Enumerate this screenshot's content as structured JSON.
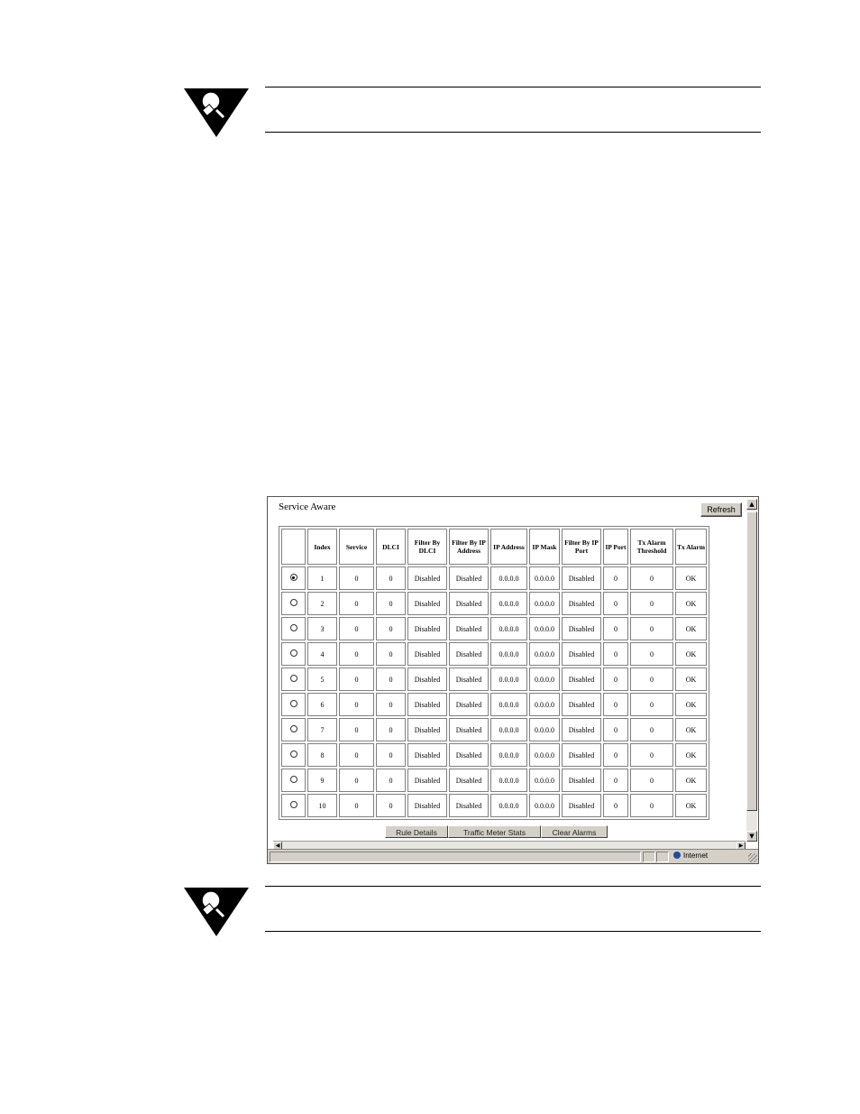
{
  "window": {
    "title": "Service Aware",
    "refresh_label": "Refresh"
  },
  "table": {
    "headers": [
      "",
      "Index",
      "Service",
      "DLCI",
      "Filter By DLCI",
      "Filter By IP Address",
      "IP Address",
      "IP Mask",
      "Filter By IP Port",
      "IP Port",
      "Tx Alarm Threshold",
      "Tx Alarm"
    ],
    "rows": [
      {
        "selected": true,
        "cells": [
          "1",
          "0",
          "0",
          "Disabled",
          "Disabled",
          "0.0.0.0",
          "0.0.0.0",
          "Disabled",
          "0",
          "0",
          "OK"
        ]
      },
      {
        "selected": false,
        "cells": [
          "2",
          "0",
          "0",
          "Disabled",
          "Disabled",
          "0.0.0.0",
          "0.0.0.0",
          "Disabled",
          "0",
          "0",
          "OK"
        ]
      },
      {
        "selected": false,
        "cells": [
          "3",
          "0",
          "0",
          "Disabled",
          "Disabled",
          "0.0.0.0",
          "0.0.0.0",
          "Disabled",
          "0",
          "0",
          "OK"
        ]
      },
      {
        "selected": false,
        "cells": [
          "4",
          "0",
          "0",
          "Disabled",
          "Disabled",
          "0.0.0.0",
          "0.0.0.0",
          "Disabled",
          "0",
          "0",
          "OK"
        ]
      },
      {
        "selected": false,
        "cells": [
          "5",
          "0",
          "0",
          "Disabled",
          "Disabled",
          "0.0.0.0",
          "0.0.0.0",
          "Disabled",
          "0",
          "0",
          "OK"
        ]
      },
      {
        "selected": false,
        "cells": [
          "6",
          "0",
          "0",
          "Disabled",
          "Disabled",
          "0.0.0.0",
          "0.0.0.0",
          "Disabled",
          "0",
          "0",
          "OK"
        ]
      },
      {
        "selected": false,
        "cells": [
          "7",
          "0",
          "0",
          "Disabled",
          "Disabled",
          "0.0.0.0",
          "0.0.0.0",
          "Disabled",
          "0",
          "0",
          "OK"
        ]
      },
      {
        "selected": false,
        "cells": [
          "8",
          "0",
          "0",
          "Disabled",
          "Disabled",
          "0.0.0.0",
          "0.0.0.0",
          "Disabled",
          "0",
          "0",
          "OK"
        ]
      },
      {
        "selected": false,
        "cells": [
          "9",
          "0",
          "0",
          "Disabled",
          "Disabled",
          "0.0.0.0",
          "0.0.0.0",
          "Disabled",
          "0",
          "0",
          "OK"
        ]
      },
      {
        "selected": false,
        "cells": [
          "10",
          "0",
          "0",
          "Disabled",
          "Disabled",
          "0.0.0.0",
          "0.0.0.0",
          "Disabled",
          "0",
          "0",
          "OK"
        ]
      }
    ]
  },
  "buttons": {
    "rule_details": "Rule Details",
    "traffic_meter_stats": "Traffic Meter Stats",
    "clear_alarms": "Clear Alarms"
  },
  "statusbar": {
    "zone": "Internet"
  },
  "icons": {
    "note": "lightbulb-note-icon",
    "zone": "globe-icon"
  }
}
